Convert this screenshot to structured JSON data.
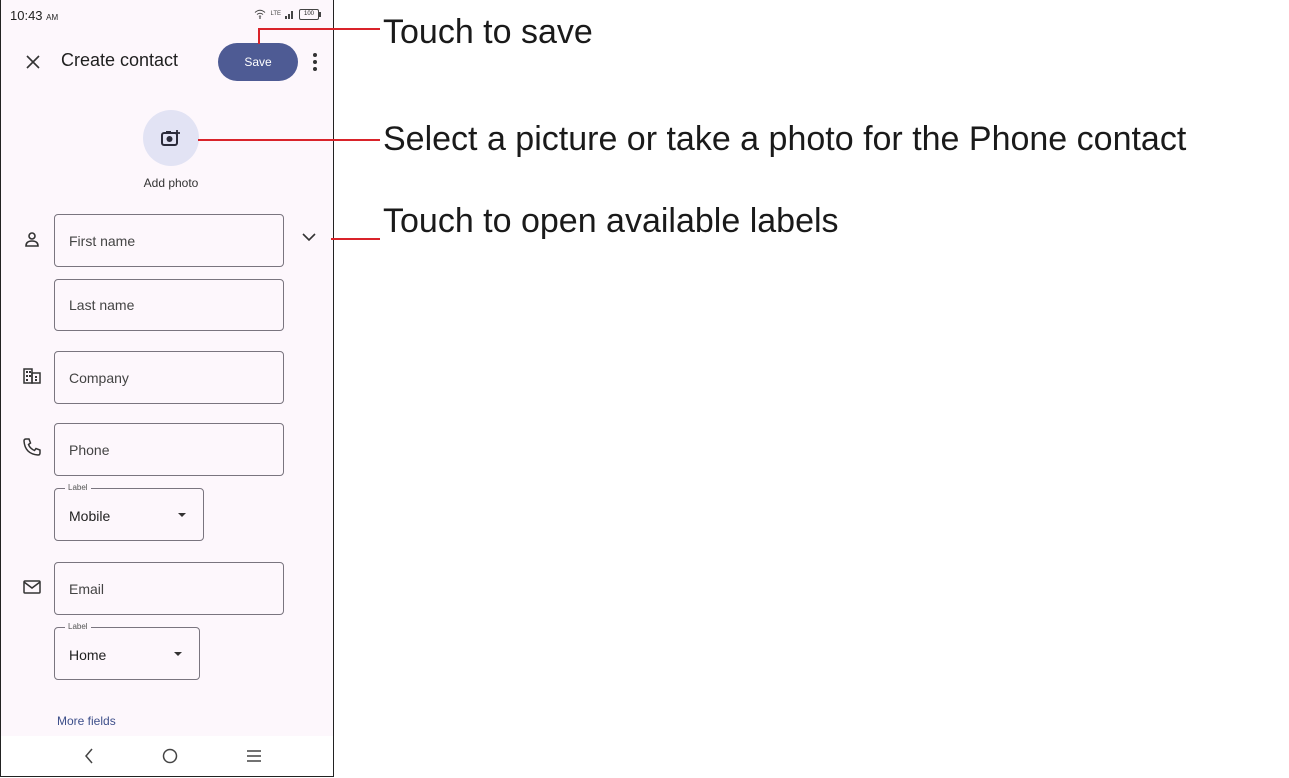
{
  "status_bar": {
    "time": "10:43",
    "ampm": "AM",
    "battery": "100",
    "network": "LTE"
  },
  "app_bar": {
    "title": "Create contact",
    "save_label": "Save"
  },
  "photo": {
    "label": "Add photo"
  },
  "fields": {
    "first_name": "First name",
    "last_name": "Last name",
    "company": "Company",
    "phone": "Phone",
    "phone_label_legend": "Label",
    "phone_label_value": "Mobile",
    "email": "Email",
    "email_label_legend": "Label",
    "email_label_value": "Home"
  },
  "more_fields": "More fields",
  "annotations": {
    "save": "Touch to save",
    "photo": "Select a picture or take a photo for the Phone contact",
    "labels": "Touch to open available labels"
  },
  "colors": {
    "accent": "#4e5b94",
    "callout": "#d9232a",
    "background": "#fdf7fc"
  }
}
